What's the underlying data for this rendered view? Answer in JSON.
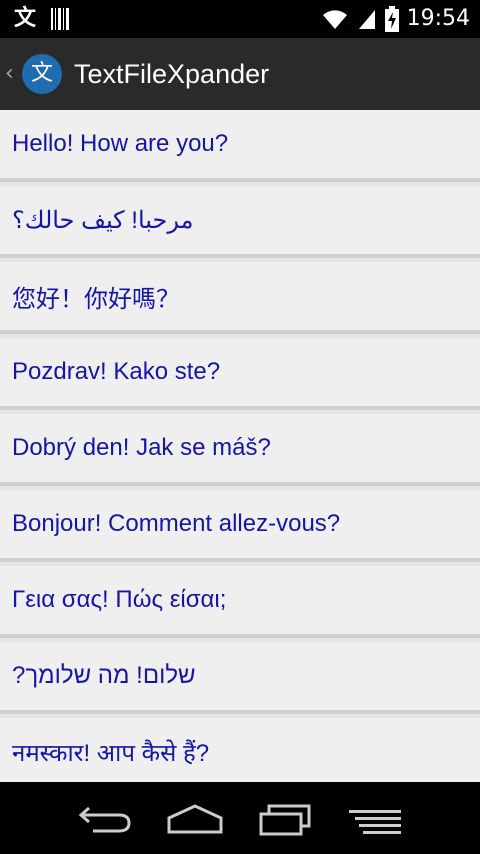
{
  "status_bar": {
    "time": "19:54",
    "left_icons": [
      "translate-notification-icon",
      "barcode-notification-icon"
    ],
    "right_icons": [
      "wifi-icon",
      "cell-signal-icon",
      "battery-charging-icon"
    ]
  },
  "action_bar": {
    "title": "TextFileXpander",
    "icon_glyph": "文"
  },
  "list": {
    "items": [
      {
        "text": "Hello! How are you?",
        "dir": "ltr"
      },
      {
        "text": "مرحبا! كيف حالك؟",
        "dir": "rtl"
      },
      {
        "text": "您好！你好嗎？",
        "dir": "ltr"
      },
      {
        "text": "Pozdrav! Kako ste?",
        "dir": "ltr"
      },
      {
        "text": "Dobrý den! Jak se máš?",
        "dir": "ltr"
      },
      {
        "text": "Bonjour! Comment allez-vous?",
        "dir": "ltr"
      },
      {
        "text": "Γεια σας! Πώς είσαι;",
        "dir": "ltr"
      },
      {
        "text": "שלום! מה שלומך?",
        "dir": "rtl"
      },
      {
        "text": "नमस्कार! आप कैसे हैं?",
        "dir": "ltr"
      }
    ]
  },
  "nav_bar": {
    "buttons": [
      "back-icon",
      "home-icon",
      "recents-icon",
      "menu-icon"
    ]
  }
}
